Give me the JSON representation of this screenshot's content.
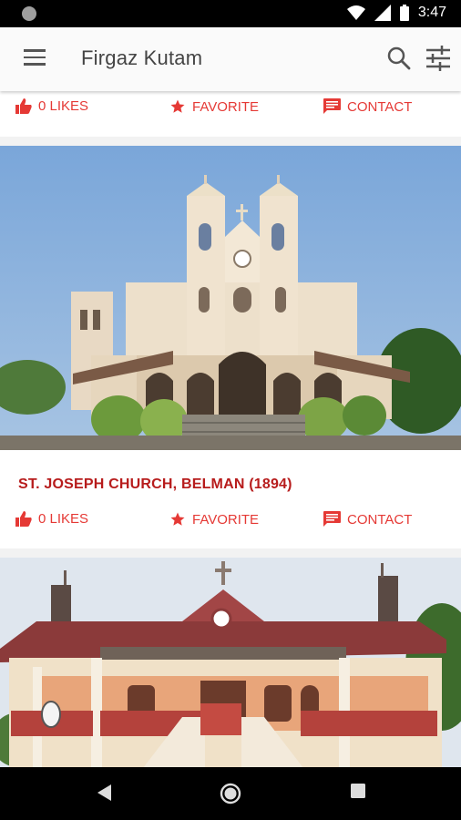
{
  "status": {
    "time": "3:47"
  },
  "app": {
    "title": "Firgaz Kutam"
  },
  "cards": [
    {
      "likes": "0 LIKES",
      "favorite": "FAVORITE",
      "contact": "CONTACT"
    },
    {
      "title": "ST. JOSEPH CHURCH, BELMAN (1894)",
      "likes": "0 LIKES",
      "favorite": "FAVORITE",
      "contact": "CONTACT"
    }
  ],
  "colors": {
    "accent": "#e53935",
    "title": "#b71c1c",
    "app_bar": "#fafafa"
  },
  "icons": [
    "menu-icon",
    "search-icon",
    "filter-icon",
    "thumbs-up-icon",
    "star-icon",
    "chat-icon",
    "back-icon",
    "home-icon",
    "recents-icon",
    "wifi-icon",
    "signal-icon",
    "battery-icon"
  ]
}
